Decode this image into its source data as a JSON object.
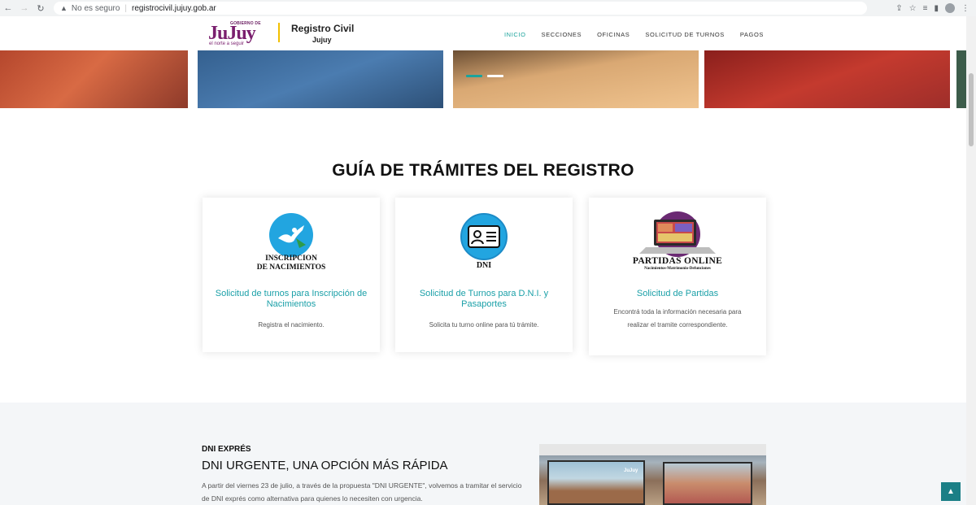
{
  "browser": {
    "security_label": "No es seguro",
    "url": "registrocivil.jujuy.gob.ar"
  },
  "header": {
    "logo": {
      "top_text": "GOBIERNO DE",
      "name": "JuJuy",
      "tagline": "el norte a seguir"
    },
    "brand_title": "Registro Civil",
    "brand_subtitle": "Jujuy",
    "nav": [
      {
        "label": "INICIO",
        "active": true
      },
      {
        "label": "SECCIONES",
        "active": false
      },
      {
        "label": "OFICINAS",
        "active": false
      },
      {
        "label": "SOLICITUD DE TURNOS",
        "active": false
      },
      {
        "label": "PAGOS",
        "active": false
      }
    ]
  },
  "guide": {
    "title": "GUÍA DE TRÁMITES DEL REGISTRO",
    "cards": [
      {
        "icon_label_1": "INSCRIPCION",
        "icon_label_2": "DE NACIMIENTOS",
        "title": "Solicitud de turnos para Inscripción de Nacimientos",
        "desc": "Registra el nacimiento."
      },
      {
        "icon_label_1": "DNI",
        "title": "Solicitud de Turnos para D.N.I. y Pasaportes",
        "desc": "Solicita tu turno online para tú trámite."
      },
      {
        "icon_label_1": "PARTIDAS ONLINE",
        "icon_label_2": "Nacimientos-Matrimonio-Defunciones",
        "title": "Solicitud de Partidas",
        "desc": "Encontrá toda la información necesaria para realizar el tramite correspondiente."
      }
    ]
  },
  "news": {
    "kicker": "DNI EXPRÉS",
    "headline": "DNI URGENTE, UNA OPCIÓN MÁS RÁPIDA",
    "body": "A partir del viernes 23 de julio, a través de la propuesta \"DNI URGENTE\", volvemos a tramitar el servicio de DNI exprés como alternativa para quienes lo necesiten con urgencia.",
    "photo_label": "JuJuy"
  },
  "colors": {
    "accent": "#1ba39c",
    "brand_purple": "#7a1f6e",
    "card_title": "#1ba0a8"
  }
}
